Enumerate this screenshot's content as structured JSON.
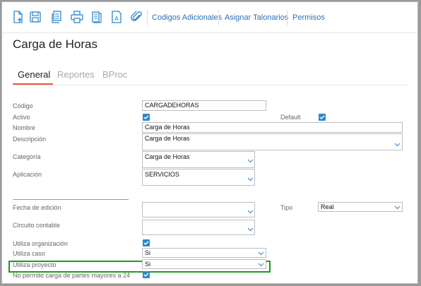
{
  "toolbar": {
    "icons": [
      "new-document-icon",
      "save-icon",
      "copy-icon",
      "print-icon",
      "document-list-icon",
      "text-document-icon",
      "attachment-icon"
    ],
    "links": [
      "Codigos Adicionales",
      "Asignar Talonarios",
      "Permisos"
    ]
  },
  "page": {
    "title": "Carga de Horas"
  },
  "tabs": [
    {
      "label": "General",
      "active": true
    },
    {
      "label": "Reportes",
      "active": false
    },
    {
      "label": "BProc",
      "active": false
    }
  ],
  "form": {
    "codigo": {
      "label": "Código",
      "value": "CARGADEHORAS"
    },
    "activo": {
      "label": "Activo",
      "checked": true
    },
    "default": {
      "label": "Default",
      "checked": true
    },
    "nombre": {
      "label": "Nombre",
      "value": "Carga de Horas"
    },
    "descripcion": {
      "label": "Descripción",
      "value": "Carga de Horas"
    },
    "categoria": {
      "label": "Categoría",
      "value": "Carga de Horas"
    },
    "aplicacion": {
      "label": "Aplicación",
      "value": "SERVICIOS"
    },
    "fecha_edicion": {
      "label": "Fecha de edición",
      "value": ""
    },
    "tipo": {
      "label": "Tipo",
      "value": "Real"
    },
    "circuito": {
      "label": "Circuito contable",
      "value": ""
    },
    "utiliza_organizacion": {
      "label": "Utiliza organización",
      "checked": true
    },
    "utiliza_caso": {
      "label": "Utiliza caso",
      "value": "Si"
    },
    "utiliza_proyecto": {
      "label": "Utiliza proyecto",
      "value": "Si"
    },
    "no_permite": {
      "label": "No permite carga de partes mayores a 24",
      "checked": true
    }
  },
  "colors": {
    "accent_tab": "#e05a3c",
    "checkbox": "#2e86c9",
    "link": "#2a6fb5",
    "highlight": "#1e9a1e"
  }
}
